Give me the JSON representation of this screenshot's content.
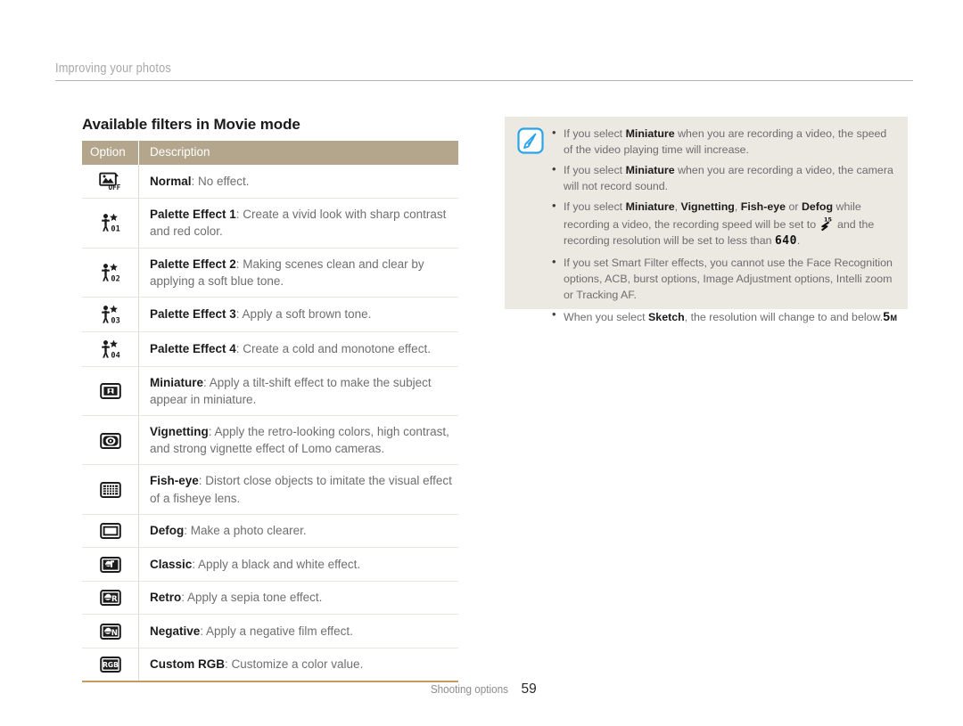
{
  "runhead": {
    "text": "Improving your photos"
  },
  "section": {
    "title": "Available filters in Movie mode"
  },
  "table": {
    "headers": {
      "option": "Option",
      "description": "Description"
    },
    "rows": [
      {
        "icon": "filter-off-icon",
        "name": "Normal",
        "desc": ": No effect."
      },
      {
        "icon": "palette-effect-1-icon",
        "name": "Palette Effect 1",
        "desc": ": Create a vivid look with sharp contrast and red color."
      },
      {
        "icon": "palette-effect-2-icon",
        "name": "Palette Effect 2",
        "desc": ": Making scenes clean and clear by applying a soft blue tone."
      },
      {
        "icon": "palette-effect-3-icon",
        "name": "Palette Effect 3",
        "desc": ": Apply a soft brown tone."
      },
      {
        "icon": "palette-effect-4-icon",
        "name": "Palette Effect 4",
        "desc": ": Create a cold and monotone effect."
      },
      {
        "icon": "miniature-icon",
        "name": "Miniature",
        "desc": ": Apply a tilt-shift effect to make the subject appear in miniature."
      },
      {
        "icon": "vignetting-icon",
        "name": "Vignetting",
        "desc": ": Apply the retro-looking colors, high contrast, and strong vignette effect of Lomo cameras."
      },
      {
        "icon": "fish-eye-icon",
        "name": "Fish-eye",
        "desc": ": Distort close objects to imitate the visual effect of a fisheye lens."
      },
      {
        "icon": "defog-icon",
        "name": "Defog",
        "desc": ": Make a photo clearer."
      },
      {
        "icon": "classic-icon",
        "name": "Classic",
        "desc": ": Apply a black and white effect."
      },
      {
        "icon": "retro-icon",
        "name": "Retro",
        "desc": ": Apply a sepia tone effect."
      },
      {
        "icon": "negative-icon",
        "name": "Negative",
        "desc": ": Apply a negative film effect."
      },
      {
        "icon": "custom-rgb-icon",
        "name": "Custom RGB",
        "desc": ": Customize a color value."
      }
    ]
  },
  "note": {
    "icon": "note-pencil-icon",
    "items": [
      {
        "p1": "If you select ",
        "b1": "Miniature",
        "p2": " when you are recording a video, the speed of the video playing time will increase."
      },
      {
        "p1": "If you select ",
        "b1": "Miniature",
        "p2": " when you are recording a video, the camera will not record sound."
      },
      {
        "p1": "If you select ",
        "b1": "Miniature",
        "sep1": ", ",
        "b2": "Vignetting",
        "sep2": ", ",
        "b3": "Fish-eye",
        "sep3": " or ",
        "b4": "Defog",
        "p2": " while recording a video, the recording speed will be set to ",
        "icon": "fps-15-icon",
        "p3": " and the recording resolution will be set to less than ",
        "badge": "640",
        "p4": "."
      },
      {
        "p1": "If you set Smart Filter effects, you cannot use the Face Recognition options, ACB, burst options, Image Adjustment options, Intelli zoom or Tracking AF."
      },
      {
        "p1": "When you select ",
        "b1": "Sketch",
        "p2": ", the resolution will change to ",
        "badge": "5",
        "badge_sub": "M",
        "p3": " and below."
      }
    ]
  },
  "footer": {
    "label": "Shooting options",
    "page": "59"
  },
  "colors": {
    "table_header_bg": "#b3a68c",
    "note_bg": "#ece9e2",
    "note_icon_blue": "#2aa3e8",
    "table_bottom_rule": "#c59b5e",
    "runhead_gray": "#a8a8a8"
  }
}
